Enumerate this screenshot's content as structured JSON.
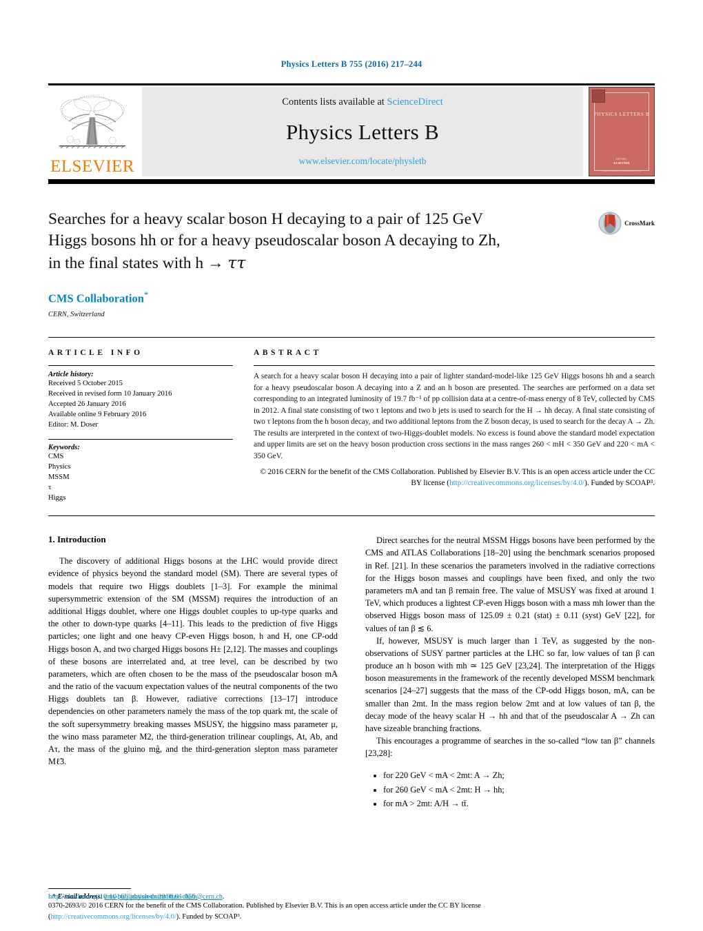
{
  "running_head": "Physics Letters B 755 (2016) 217–244",
  "masthead": {
    "contents_prefix": "Contents lists available at ",
    "contents_link": "ScienceDirect",
    "journal_title": "Physics Letters B",
    "journal_url": "www.elsevier.com/locate/physletb",
    "publisher_wordmark": "ELSEVIER",
    "cover": {
      "title": "PHYSICS LETTERS B",
      "foot1": "EDITORS :",
      "foot2": "ELSEVIER",
      "foot3": "Available online at www.sciencedirect.com"
    }
  },
  "title_block": {
    "title_line1": "Searches for a heavy scalar boson H decaying to a pair of 125 GeV",
    "title_line2": "Higgs bosons hh or for a heavy pseudoscalar boson A decaying to Zh,",
    "title_line3_pre": "in the final states with h",
    "title_line3_arrow": "→",
    "title_line3_tau": "ττ",
    "authors": "CMS Collaboration",
    "author_mark": "✩",
    "affiliation": "CERN, Switzerland",
    "crossmark_label": "CrossMark"
  },
  "article_info": {
    "heading": "ARTICLE INFO",
    "history_label": "Article history:",
    "history": [
      "Received 5 October 2015",
      "Received in revised form 10 January 2016",
      "Accepted 26 January 2016",
      "Available online 9 February 2016",
      "Editor: M. Doser"
    ],
    "keywords_label": "Keywords:",
    "keywords": [
      "CMS",
      "Physics",
      "MSSM",
      "τ",
      "Higgs"
    ]
  },
  "abstract": {
    "heading": "ABSTRACT",
    "text": "A search for a heavy scalar boson H decaying into a pair of lighter standard-model-like 125 GeV Higgs bosons hh and a search for a heavy pseudoscalar boson A decaying into a Z and an h boson are presented. The searches are performed on a data set corresponding to an integrated luminosity of 19.7 fb⁻¹ of pp collision data at a centre-of-mass energy of 8 TeV, collected by CMS in 2012. A final state consisting of two τ leptons and two b jets is used to search for the H → hh decay. A final state consisting of two τ leptons from the h boson decay, and two additional leptons from the Z boson decay, is used to search for the decay A → Zh. The results are interpreted in the context of two-Higgs-doublet models. No excess is found above the standard model expectation and upper limits are set on the heavy boson production cross sections in the mass ranges 260 < mH < 350 GeV and 220 < mA < 350 GeV.",
    "copyright_pre": "© 2016 CERN for the benefit of the CMS Collaboration. Published by Elsevier B.V. This is an open access article under the CC BY license (",
    "copyright_link": "http://creativecommons.org/licenses/by/4.0/",
    "copyright_post": "). Funded by SCOAP³."
  },
  "body": {
    "section_title": "1. Introduction",
    "left_paragraphs": [
      "The discovery of additional Higgs bosons at the LHC would provide direct evidence of physics beyond the standard model (SM). There are several types of models that require two Higgs doublets [1–3]. For example the minimal supersymmetric extension of the SM (MSSM) requires the introduction of an additional Higgs doublet, where one Higgs doublet couples to up-type quarks and the other to down-type quarks [4–11]. This leads to the prediction of five Higgs particles; one light and one heavy CP-even Higgs boson, h and H, one CP-odd Higgs boson A, and two charged Higgs bosons H± [2,12]. The masses and couplings of these bosons are interrelated and, at tree level, can be described by two parameters, which are often chosen to be the mass of the pseudoscalar boson mA and the ratio of the vacuum expectation values of the neutral components of the two Higgs doublets tan β. However, radiative corrections [13–17] introduce dependencies on other parameters namely the mass of the top quark mt, the scale of the soft supersymmetry breaking masses MSUSY, the higgsino mass parameter μ, the wino mass parameter M2, the third-generation trilinear couplings, At, Ab, and Aτ, the mass of the gluino mg̃, and the third-generation slepton mass parameter Mℓ̃3."
    ],
    "right_paragraphs": [
      "Direct searches for the neutral MSSM Higgs bosons have been performed by the CMS and ATLAS Collaborations [18–20] using the benchmark scenarios proposed in Ref. [21]. In these scenarios the parameters involved in the radiative corrections for the Higgs boson masses and couplings have been fixed, and only the two parameters mA and tan β remain free. The value of MSUSY was fixed at around 1 TeV, which produces a lightest CP-even Higgs boson with a mass mh lower than the observed Higgs boson mass of 125.09 ± 0.21 (stat) ± 0.11 (syst) GeV [22], for values of tan β ≲ 6.",
      "If, however, MSUSY is much larger than 1 TeV, as suggested by the non-observations of SUSY partner particles at the LHC so far, low values of tan β can produce an h boson with mh ≃ 125 GeV [23,24]. The interpretation of the Higgs boson measurements in the framework of the recently developed MSSM benchmark scenarios [24–27] suggests that the mass of the CP-odd Higgs boson, mA, can be smaller than 2mt. In the mass region below 2mt and at low values of tan β, the decay mode of the heavy scalar H → hh and that of the pseudoscalar A → Zh can have sizeable branching fractions.",
      "This encourages a programme of searches in the so-called “low tan β” channels [23,28]:"
    ],
    "bullets": [
      "for 220 GeV < mA < 2mt: A → Zh;",
      "for 260 GeV < mA < 2mt: H → hh;",
      "for mA > 2mt: A/H → tt̄."
    ]
  },
  "footnote": {
    "mark": "✩",
    "label": "E-mail address:",
    "email": "cms-publication-committee-chair@cern.ch",
    "trailing": "."
  },
  "page_footer": {
    "doi": "http://dx.doi.org/10.1016/j.physletb.2016.01.056",
    "line1": "0370-2693/© 2016 CERN for the benefit of the CMS Collaboration. Published by Elsevier B.V. This is an open access article under the CC BY license",
    "link": "http://creativecommons.org/licenses/by/4.0/",
    "line2_pre": "(",
    "line2_post": "). Funded by SCOAP³."
  },
  "colors": {
    "link": "#2b9fd4",
    "reference": "#0d84b8",
    "elsevier_orange": "#f07c00",
    "cover_red": "#c9695f"
  }
}
